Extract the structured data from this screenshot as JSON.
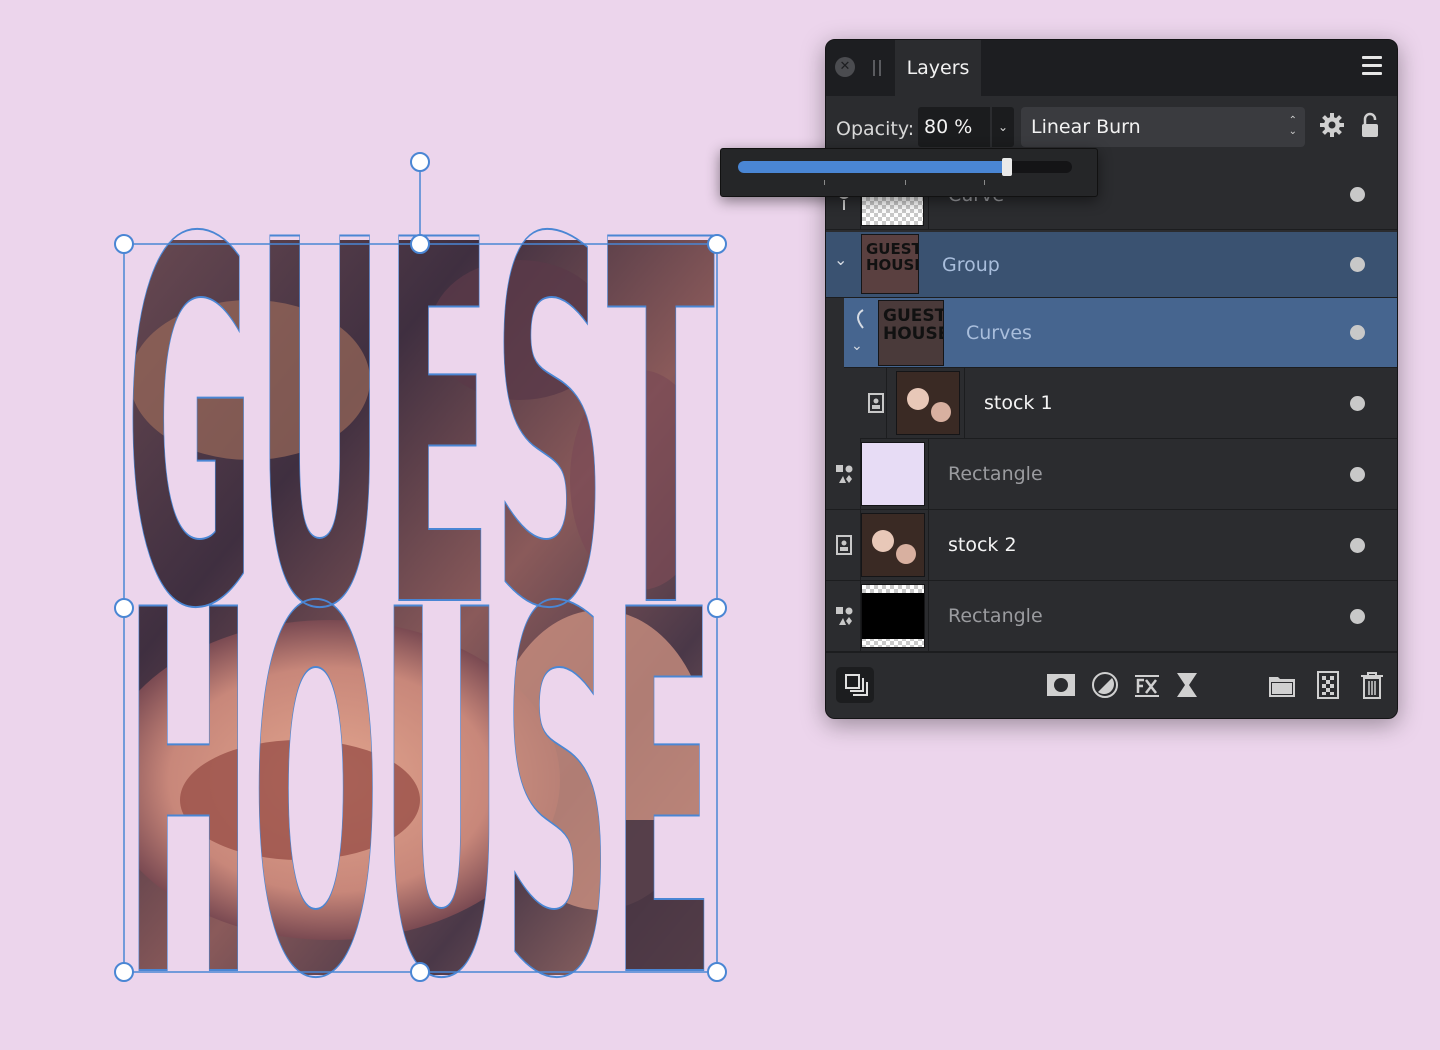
{
  "canvas": {
    "text_line1": "GUEST",
    "text_line2": "HOUSE"
  },
  "panel": {
    "tab_label": "Layers",
    "opacity_label": "Opacity:",
    "opacity_value": "80 %",
    "opacity_fraction": 0.8,
    "blend_mode": "Linear Burn",
    "layers": [
      {
        "label": "Curve",
        "type": "curve",
        "selected": false
      },
      {
        "label": "Group",
        "type": "group",
        "selected": true
      },
      {
        "label": "Curves",
        "type": "curves",
        "selected": true
      },
      {
        "label": "stock 1",
        "type": "image",
        "selected": false
      },
      {
        "label": "Rectangle",
        "type": "shape",
        "selected": false
      },
      {
        "label": "stock 2",
        "type": "image",
        "selected": false
      },
      {
        "label": "Rectangle",
        "type": "shape",
        "selected": false
      }
    ]
  },
  "colors": {
    "canvas_background": "#ecd5ec",
    "selection_blue": "#4a86d4",
    "panel_background": "#2b2c2f",
    "selected_row": "#46658f"
  }
}
